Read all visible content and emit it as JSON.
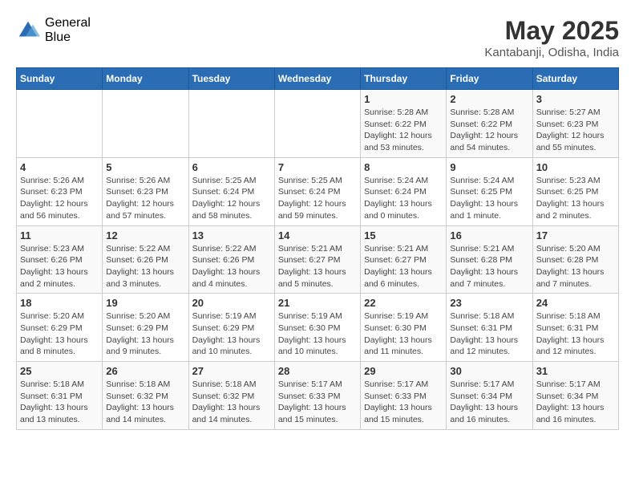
{
  "logo": {
    "general": "General",
    "blue": "Blue"
  },
  "title": {
    "month_year": "May 2025",
    "location": "Kantabanji, Odisha, India"
  },
  "weekdays": [
    "Sunday",
    "Monday",
    "Tuesday",
    "Wednesday",
    "Thursday",
    "Friday",
    "Saturday"
  ],
  "weeks": [
    [
      {
        "day": "",
        "info": ""
      },
      {
        "day": "",
        "info": ""
      },
      {
        "day": "",
        "info": ""
      },
      {
        "day": "",
        "info": ""
      },
      {
        "day": "1",
        "info": "Sunrise: 5:28 AM\nSunset: 6:22 PM\nDaylight: 12 hours\nand 53 minutes."
      },
      {
        "day": "2",
        "info": "Sunrise: 5:28 AM\nSunset: 6:22 PM\nDaylight: 12 hours\nand 54 minutes."
      },
      {
        "day": "3",
        "info": "Sunrise: 5:27 AM\nSunset: 6:23 PM\nDaylight: 12 hours\nand 55 minutes."
      }
    ],
    [
      {
        "day": "4",
        "info": "Sunrise: 5:26 AM\nSunset: 6:23 PM\nDaylight: 12 hours\nand 56 minutes."
      },
      {
        "day": "5",
        "info": "Sunrise: 5:26 AM\nSunset: 6:23 PM\nDaylight: 12 hours\nand 57 minutes."
      },
      {
        "day": "6",
        "info": "Sunrise: 5:25 AM\nSunset: 6:24 PM\nDaylight: 12 hours\nand 58 minutes."
      },
      {
        "day": "7",
        "info": "Sunrise: 5:25 AM\nSunset: 6:24 PM\nDaylight: 12 hours\nand 59 minutes."
      },
      {
        "day": "8",
        "info": "Sunrise: 5:24 AM\nSunset: 6:24 PM\nDaylight: 13 hours\nand 0 minutes."
      },
      {
        "day": "9",
        "info": "Sunrise: 5:24 AM\nSunset: 6:25 PM\nDaylight: 13 hours\nand 1 minute."
      },
      {
        "day": "10",
        "info": "Sunrise: 5:23 AM\nSunset: 6:25 PM\nDaylight: 13 hours\nand 2 minutes."
      }
    ],
    [
      {
        "day": "11",
        "info": "Sunrise: 5:23 AM\nSunset: 6:26 PM\nDaylight: 13 hours\nand 2 minutes."
      },
      {
        "day": "12",
        "info": "Sunrise: 5:22 AM\nSunset: 6:26 PM\nDaylight: 13 hours\nand 3 minutes."
      },
      {
        "day": "13",
        "info": "Sunrise: 5:22 AM\nSunset: 6:26 PM\nDaylight: 13 hours\nand 4 minutes."
      },
      {
        "day": "14",
        "info": "Sunrise: 5:21 AM\nSunset: 6:27 PM\nDaylight: 13 hours\nand 5 minutes."
      },
      {
        "day": "15",
        "info": "Sunrise: 5:21 AM\nSunset: 6:27 PM\nDaylight: 13 hours\nand 6 minutes."
      },
      {
        "day": "16",
        "info": "Sunrise: 5:21 AM\nSunset: 6:28 PM\nDaylight: 13 hours\nand 7 minutes."
      },
      {
        "day": "17",
        "info": "Sunrise: 5:20 AM\nSunset: 6:28 PM\nDaylight: 13 hours\nand 7 minutes."
      }
    ],
    [
      {
        "day": "18",
        "info": "Sunrise: 5:20 AM\nSunset: 6:29 PM\nDaylight: 13 hours\nand 8 minutes."
      },
      {
        "day": "19",
        "info": "Sunrise: 5:20 AM\nSunset: 6:29 PM\nDaylight: 13 hours\nand 9 minutes."
      },
      {
        "day": "20",
        "info": "Sunrise: 5:19 AM\nSunset: 6:29 PM\nDaylight: 13 hours\nand 10 minutes."
      },
      {
        "day": "21",
        "info": "Sunrise: 5:19 AM\nSunset: 6:30 PM\nDaylight: 13 hours\nand 10 minutes."
      },
      {
        "day": "22",
        "info": "Sunrise: 5:19 AM\nSunset: 6:30 PM\nDaylight: 13 hours\nand 11 minutes."
      },
      {
        "day": "23",
        "info": "Sunrise: 5:18 AM\nSunset: 6:31 PM\nDaylight: 13 hours\nand 12 minutes."
      },
      {
        "day": "24",
        "info": "Sunrise: 5:18 AM\nSunset: 6:31 PM\nDaylight: 13 hours\nand 12 minutes."
      }
    ],
    [
      {
        "day": "25",
        "info": "Sunrise: 5:18 AM\nSunset: 6:31 PM\nDaylight: 13 hours\nand 13 minutes."
      },
      {
        "day": "26",
        "info": "Sunrise: 5:18 AM\nSunset: 6:32 PM\nDaylight: 13 hours\nand 14 minutes."
      },
      {
        "day": "27",
        "info": "Sunrise: 5:18 AM\nSunset: 6:32 PM\nDaylight: 13 hours\nand 14 minutes."
      },
      {
        "day": "28",
        "info": "Sunrise: 5:17 AM\nSunset: 6:33 PM\nDaylight: 13 hours\nand 15 minutes."
      },
      {
        "day": "29",
        "info": "Sunrise: 5:17 AM\nSunset: 6:33 PM\nDaylight: 13 hours\nand 15 minutes."
      },
      {
        "day": "30",
        "info": "Sunrise: 5:17 AM\nSunset: 6:34 PM\nDaylight: 13 hours\nand 16 minutes."
      },
      {
        "day": "31",
        "info": "Sunrise: 5:17 AM\nSunset: 6:34 PM\nDaylight: 13 hours\nand 16 minutes."
      }
    ]
  ]
}
